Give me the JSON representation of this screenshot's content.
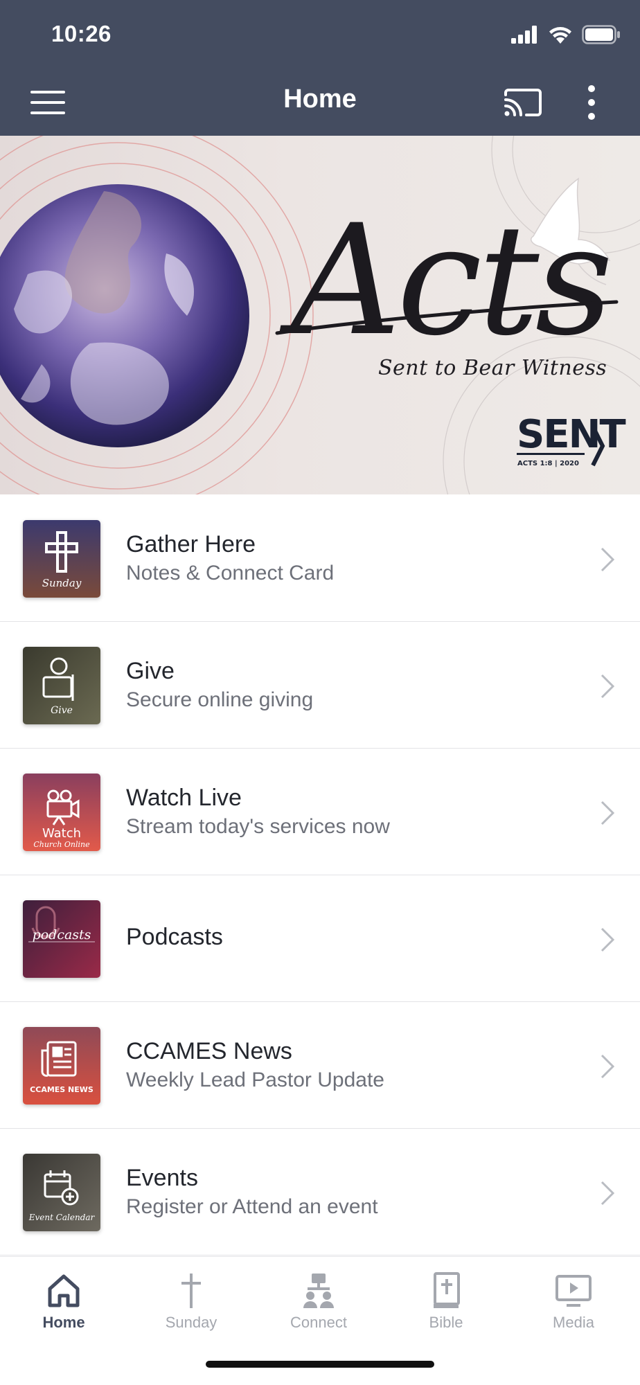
{
  "status_bar": {
    "time": "10:26"
  },
  "app_bar": {
    "title": "Home"
  },
  "hero": {
    "title": "Acts",
    "subtitle": "Sent to Bear Witness",
    "logo_text": "SENT",
    "logo_caption": "ACTS 1:8 | 2020"
  },
  "list": [
    {
      "title": "Gather Here",
      "subtitle": "Notes & Connect Card",
      "thumb_label": "Sunday",
      "icon": "cross-icon"
    },
    {
      "title": "Give",
      "subtitle": "Secure online giving",
      "thumb_label": "Give",
      "icon": "give-icon"
    },
    {
      "title": "Watch Live",
      "subtitle": "Stream today's services now",
      "thumb_label": "Watch",
      "thumb_label2": "Church Online",
      "icon": "video-camera-icon"
    },
    {
      "title": "Podcasts",
      "subtitle": "",
      "thumb_label": "podcasts",
      "icon": "microphone-icon"
    },
    {
      "title": "CCAMES News",
      "subtitle": "Weekly Lead Pastor Update",
      "thumb_label": "CCAMES NEWS",
      "icon": "newspaper-icon"
    },
    {
      "title": "Events",
      "subtitle": "Register or Attend an event",
      "thumb_label": "Event Calendar",
      "icon": "calendar-icon"
    }
  ],
  "tabs": [
    {
      "label": "Home",
      "icon": "home-icon",
      "active": true
    },
    {
      "label": "Sunday",
      "icon": "cross-icon",
      "active": false
    },
    {
      "label": "Connect",
      "icon": "connect-icon",
      "active": false
    },
    {
      "label": "Bible",
      "icon": "bible-icon",
      "active": false
    },
    {
      "label": "Media",
      "icon": "media-icon",
      "active": false
    }
  ],
  "colors": {
    "app_bar": "#444c60",
    "tab_active": "#444c60",
    "tab_inactive": "#a4a7ae",
    "row_subtitle": "#6d7079"
  }
}
